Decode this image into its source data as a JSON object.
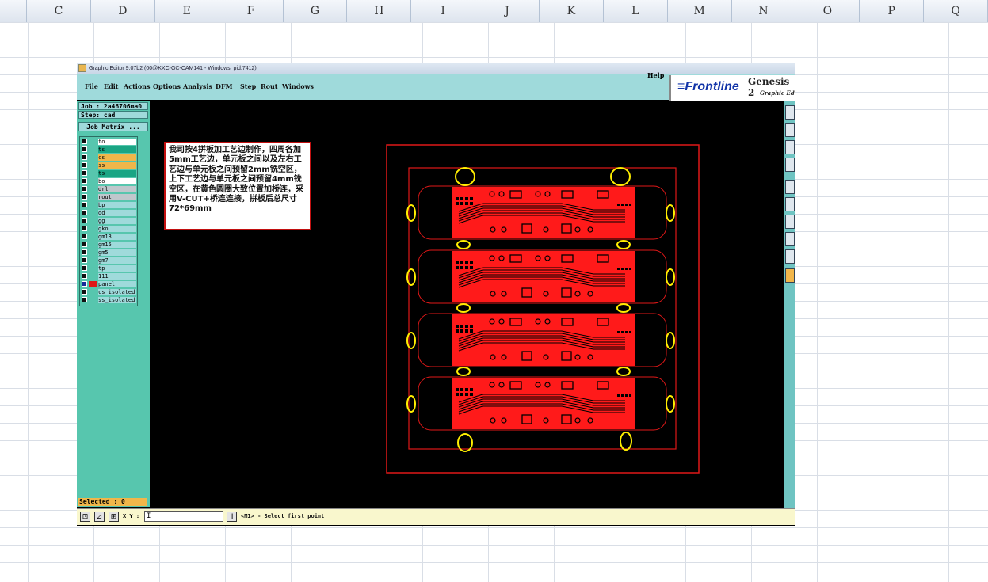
{
  "spreadsheet": {
    "columns": [
      "C",
      "D",
      "E",
      "F",
      "G",
      "H",
      "I",
      "J",
      "K",
      "L",
      "M",
      "N",
      "O",
      "P",
      "Q"
    ]
  },
  "window": {
    "title": "Graphic Editor 9.07b2 (00@KXC-GC-CAM141 - Windows, pid:7412)"
  },
  "menu": {
    "items": [
      "File",
      "Edit",
      "Actions",
      "Options",
      "Analysis",
      "DFM",
      "Step",
      "Rout",
      "Windows"
    ],
    "help": "Help"
  },
  "logo": {
    "brand": "Frontline",
    "product": "Genesis 2",
    "subtitle": "Graphic Edi"
  },
  "job": {
    "job_label": "Job : 2a46706ma0",
    "step_label": "Step: cad",
    "matrix_button": "Job Matrix ..."
  },
  "layers": [
    {
      "name": "to",
      "color": "#ffffff"
    },
    {
      "name": "ts",
      "color": "#1aa584"
    },
    {
      "name": "cs",
      "color": "#f1b64a"
    },
    {
      "name": "ss",
      "color": "#f1b64a"
    },
    {
      "name": "ts",
      "color": "#1aa584"
    },
    {
      "name": "bo",
      "color": "#ffffff"
    },
    {
      "name": "drl",
      "color": "#bfc7cc"
    },
    {
      "name": "rout",
      "color": "#bfc7cc"
    },
    {
      "name": "bp",
      "color": "#9fdadb"
    },
    {
      "name": "dd",
      "color": "#9fdadb"
    },
    {
      "name": "gg",
      "color": "#9fdadb"
    },
    {
      "name": "gko",
      "color": "#9fdadb"
    },
    {
      "name": "gm13",
      "color": "#9fdadb"
    },
    {
      "name": "gm15",
      "color": "#9fdadb"
    },
    {
      "name": "gm5",
      "color": "#9fdadb"
    },
    {
      "name": "gm7",
      "color": "#9fdadb"
    },
    {
      "name": "tp",
      "color": "#9fdadb"
    },
    {
      "name": "111",
      "color": "#9fdadb"
    },
    {
      "name": "panel",
      "color": "#9fdadb"
    },
    {
      "name": "cs_isolated",
      "color": "#9fdadb"
    },
    {
      "name": "ss_isolated",
      "color": "#9fdadb"
    }
  ],
  "selected_label": "Selected : 0",
  "note": "我司按4拼板加工艺边制作，四周各加5mm工艺边，单元板之间以及左右工艺边与单元板之间预留2mm铣空区，上下工艺边与单元板之间预留4mm铣空区，在黄色圆圈大致位置加桥连，采用V-CUT+桥连连接，拼板后总尺寸72*69mm",
  "bottom": {
    "xy_label": "X Y :",
    "xy_value": "I",
    "status": "<M1> - Select first point"
  },
  "colors": {
    "board_red": "#ff1a1a",
    "outline_red": "#e01818",
    "bridge_yellow": "#ffee00",
    "canvas_black": "#000000",
    "panel_teal": "#57c6ae"
  }
}
